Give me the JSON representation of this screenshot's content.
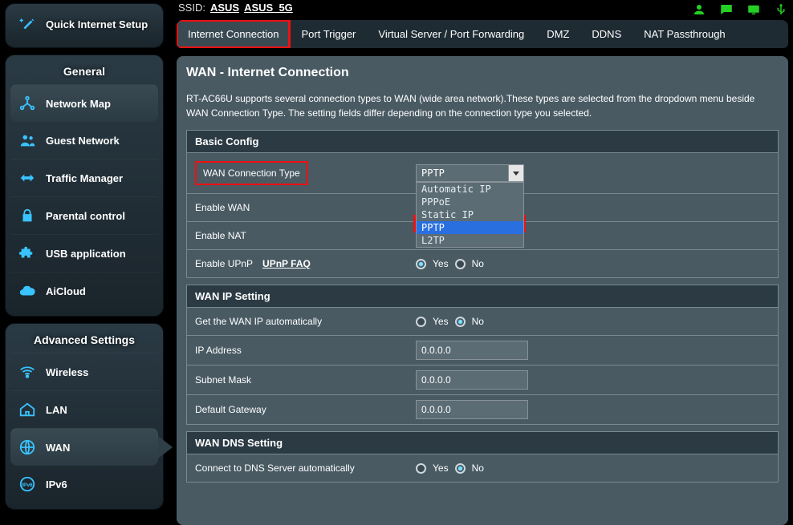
{
  "ssid": {
    "label": "SSID:",
    "v1": "ASUS",
    "v2": "ASUS_5G"
  },
  "qis": {
    "label": "Quick Internet Setup"
  },
  "sidebar": {
    "general_title": "General",
    "advanced_title": "Advanced Settings",
    "general": [
      {
        "label": "Network Map"
      },
      {
        "label": "Guest Network"
      },
      {
        "label": "Traffic Manager"
      },
      {
        "label": "Parental control"
      },
      {
        "label": "USB application"
      },
      {
        "label": "AiCloud"
      }
    ],
    "advanced": [
      {
        "label": "Wireless"
      },
      {
        "label": "LAN"
      },
      {
        "label": "WAN"
      },
      {
        "label": "IPv6"
      }
    ]
  },
  "tabs": [
    {
      "label": "Internet Connection"
    },
    {
      "label": "Port Trigger"
    },
    {
      "label": "Virtual Server / Port Forwarding"
    },
    {
      "label": "DMZ"
    },
    {
      "label": "DDNS"
    },
    {
      "label": "NAT Passthrough"
    }
  ],
  "page": {
    "title": "WAN - Internet Connection",
    "desc": "RT-AC66U supports several connection types to WAN (wide area network).These types are selected from the dropdown menu beside WAN Connection Type. The setting fields differ depending on the connection type you selected."
  },
  "sections": {
    "basic": {
      "title": "Basic Config",
      "conn_type_label": "WAN Connection Type",
      "conn_type_value": "PPTP",
      "conn_type_options": [
        "Automatic IP",
        "PPPoE",
        "Static IP",
        "PPTP",
        "L2TP"
      ],
      "enable_wan_label": "Enable WAN",
      "enable_nat_label": "Enable NAT",
      "enable_upnp_label": "Enable UPnP",
      "upnp_faq": "UPnP  FAQ",
      "yes": "Yes",
      "no": "No"
    },
    "wanip": {
      "title": "WAN IP Setting",
      "auto_label": "Get the WAN IP automatically",
      "ip_label": "IP Address",
      "ip_value": "0.0.0.0",
      "mask_label": "Subnet Mask",
      "mask_value": "0.0.0.0",
      "gw_label": "Default Gateway",
      "gw_value": "0.0.0.0"
    },
    "dns": {
      "title": "WAN DNS Setting",
      "auto_label": "Connect to DNS Server automatically"
    }
  }
}
